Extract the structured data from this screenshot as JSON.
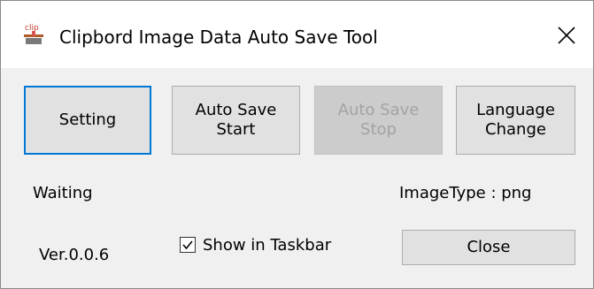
{
  "window": {
    "title": "Clipbord Image Data Auto Save Tool",
    "icon": "clip-icon",
    "icon_text": "clip",
    "close_glyph": "✕"
  },
  "buttons": {
    "setting": "Setting",
    "auto_save_start": "Auto Save\nStart",
    "auto_save_stop": "Auto Save\nStop",
    "language_change": "Language\nChange",
    "close": "Close"
  },
  "status": {
    "state": "Waiting",
    "image_type": "ImageType : png",
    "version": "Ver.0.0.6"
  },
  "options": {
    "show_in_taskbar_label": "Show in Taskbar",
    "show_in_taskbar_checked": true
  },
  "colors": {
    "accent_focus": "#0078d7",
    "button_face": "#e1e1e1",
    "disabled_face": "#cccccc",
    "disabled_text": "#a3a3a3"
  }
}
